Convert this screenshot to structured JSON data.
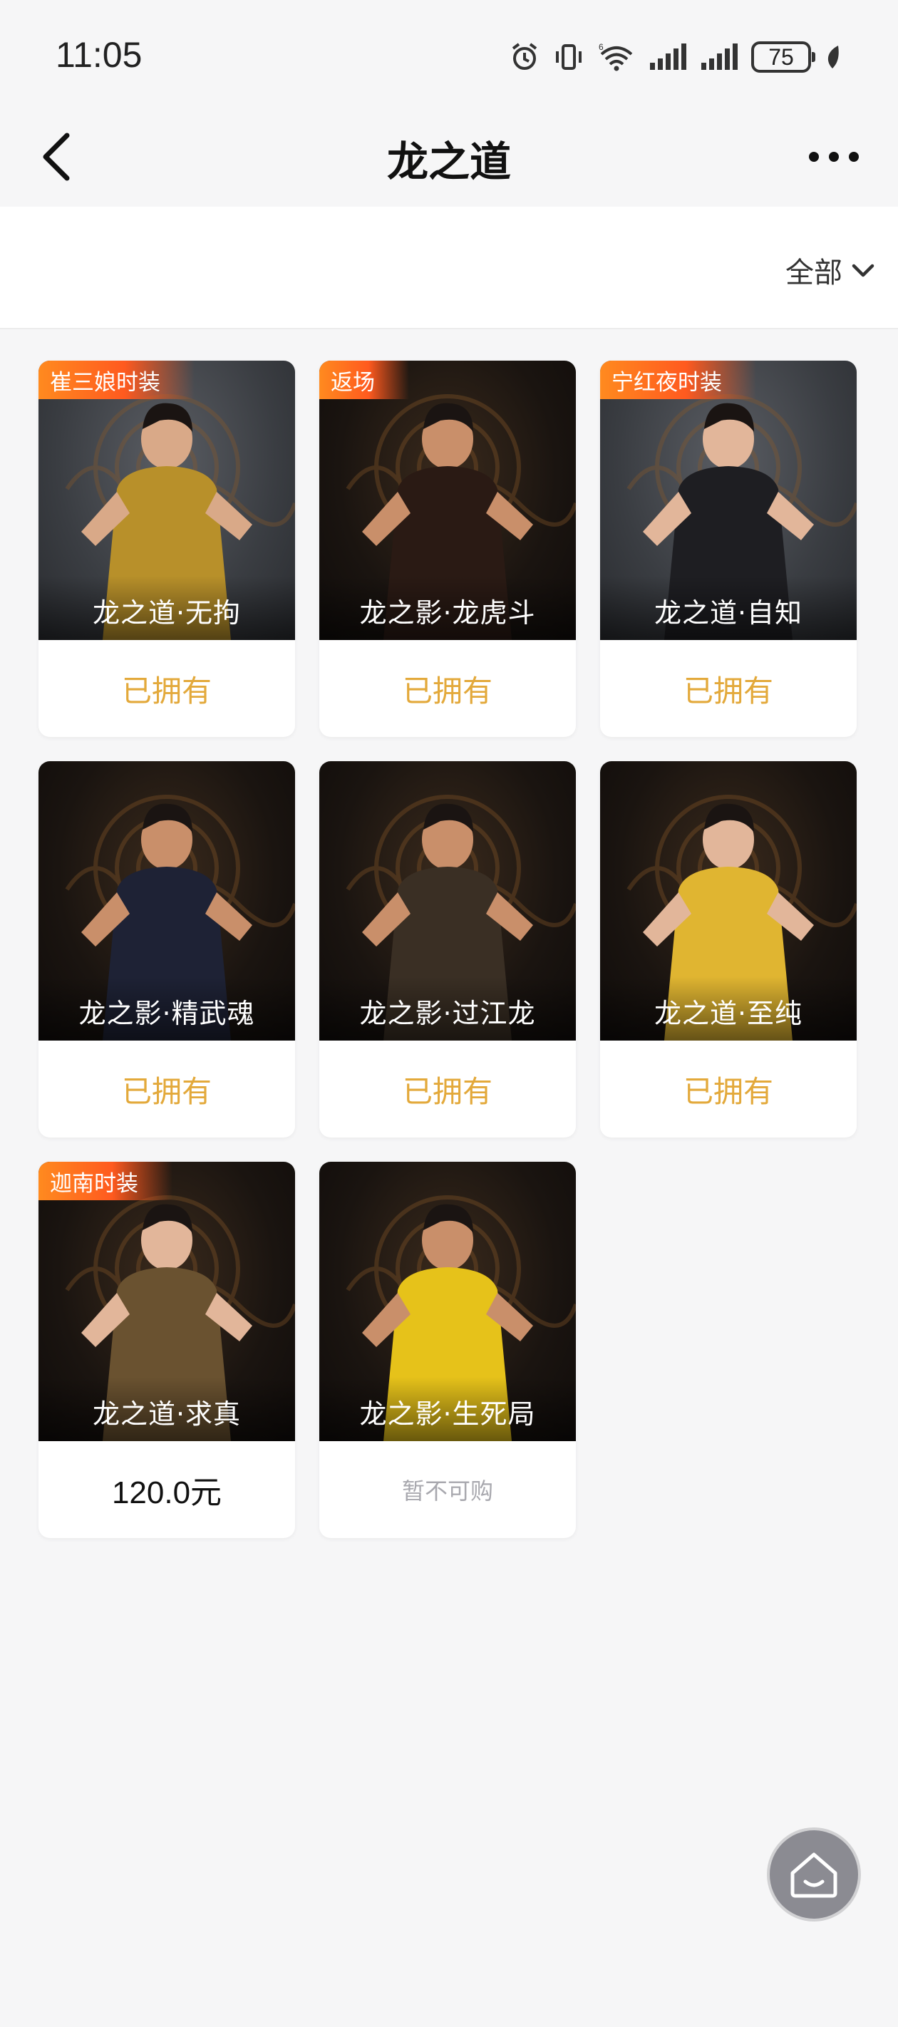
{
  "status_bar": {
    "time": "11:05",
    "battery": "75",
    "icons": [
      "alarm-icon",
      "vibrate-icon",
      "wifi-6-icon",
      "signal-icon",
      "signal-icon",
      "battery-icon",
      "leaf-icon"
    ]
  },
  "nav": {
    "title": "龙之道",
    "back_icon": "chevron-left-icon",
    "more_icon": "more-dots-icon"
  },
  "filter": {
    "label": "全部",
    "icon": "chevron-down-icon"
  },
  "items": [
    {
      "name": "龙之道·无拘",
      "badge": "崔三娘时装",
      "status": "已拥有",
      "status_type": "owned",
      "bg": "grey"
    },
    {
      "name": "龙之影·龙虎斗",
      "badge": "返场",
      "status": "已拥有",
      "status_type": "owned",
      "bg": "dark"
    },
    {
      "name": "龙之道·自知",
      "badge": "宁红夜时装",
      "status": "已拥有",
      "status_type": "owned",
      "bg": "grey"
    },
    {
      "name": "龙之影·精武魂",
      "badge": "",
      "status": "已拥有",
      "status_type": "owned",
      "bg": "dark"
    },
    {
      "name": "龙之影·过江龙",
      "badge": "",
      "status": "已拥有",
      "status_type": "owned",
      "bg": "dark"
    },
    {
      "name": "龙之道·至纯",
      "badge": "",
      "status": "已拥有",
      "status_type": "owned",
      "bg": "dark"
    },
    {
      "name": "龙之道·求真",
      "badge": "迦南时装",
      "status": "120.0元",
      "status_type": "price",
      "bg": "dark"
    },
    {
      "name": "龙之影·生死局",
      "badge": "",
      "status": "暂不可购",
      "status_type": "unavailable",
      "bg": "dark"
    }
  ],
  "colors": {
    "owned_text": "#e3a93b",
    "badge_start": "#ff8a1f",
    "page_bg": "#f6f6f7"
  },
  "home_button_icon": "home-icon"
}
